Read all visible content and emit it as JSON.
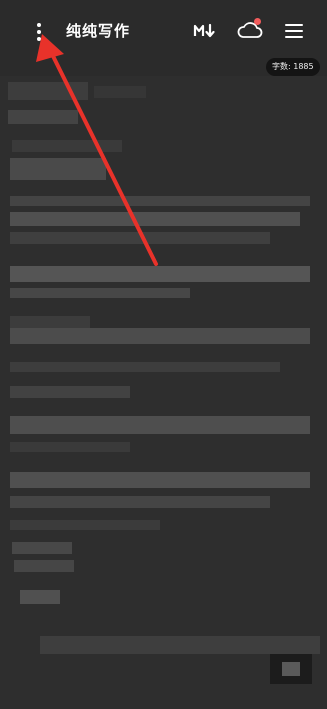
{
  "header": {
    "title": "纯纯写作",
    "markdown_label": "M↓",
    "more_icon": "vertical-dots-icon",
    "cloud_icon": "cloud-sync-icon",
    "menu_icon": "hamburger-menu-icon",
    "cloud_badge_color": "#f25c5c"
  },
  "status": {
    "word_count": "字数: 1885"
  },
  "annotation": {
    "arrow_color": "#e8322a"
  },
  "colors": {
    "background": "#2b2b2b",
    "text": "#ffffff",
    "word_count_bg": "#141414"
  }
}
